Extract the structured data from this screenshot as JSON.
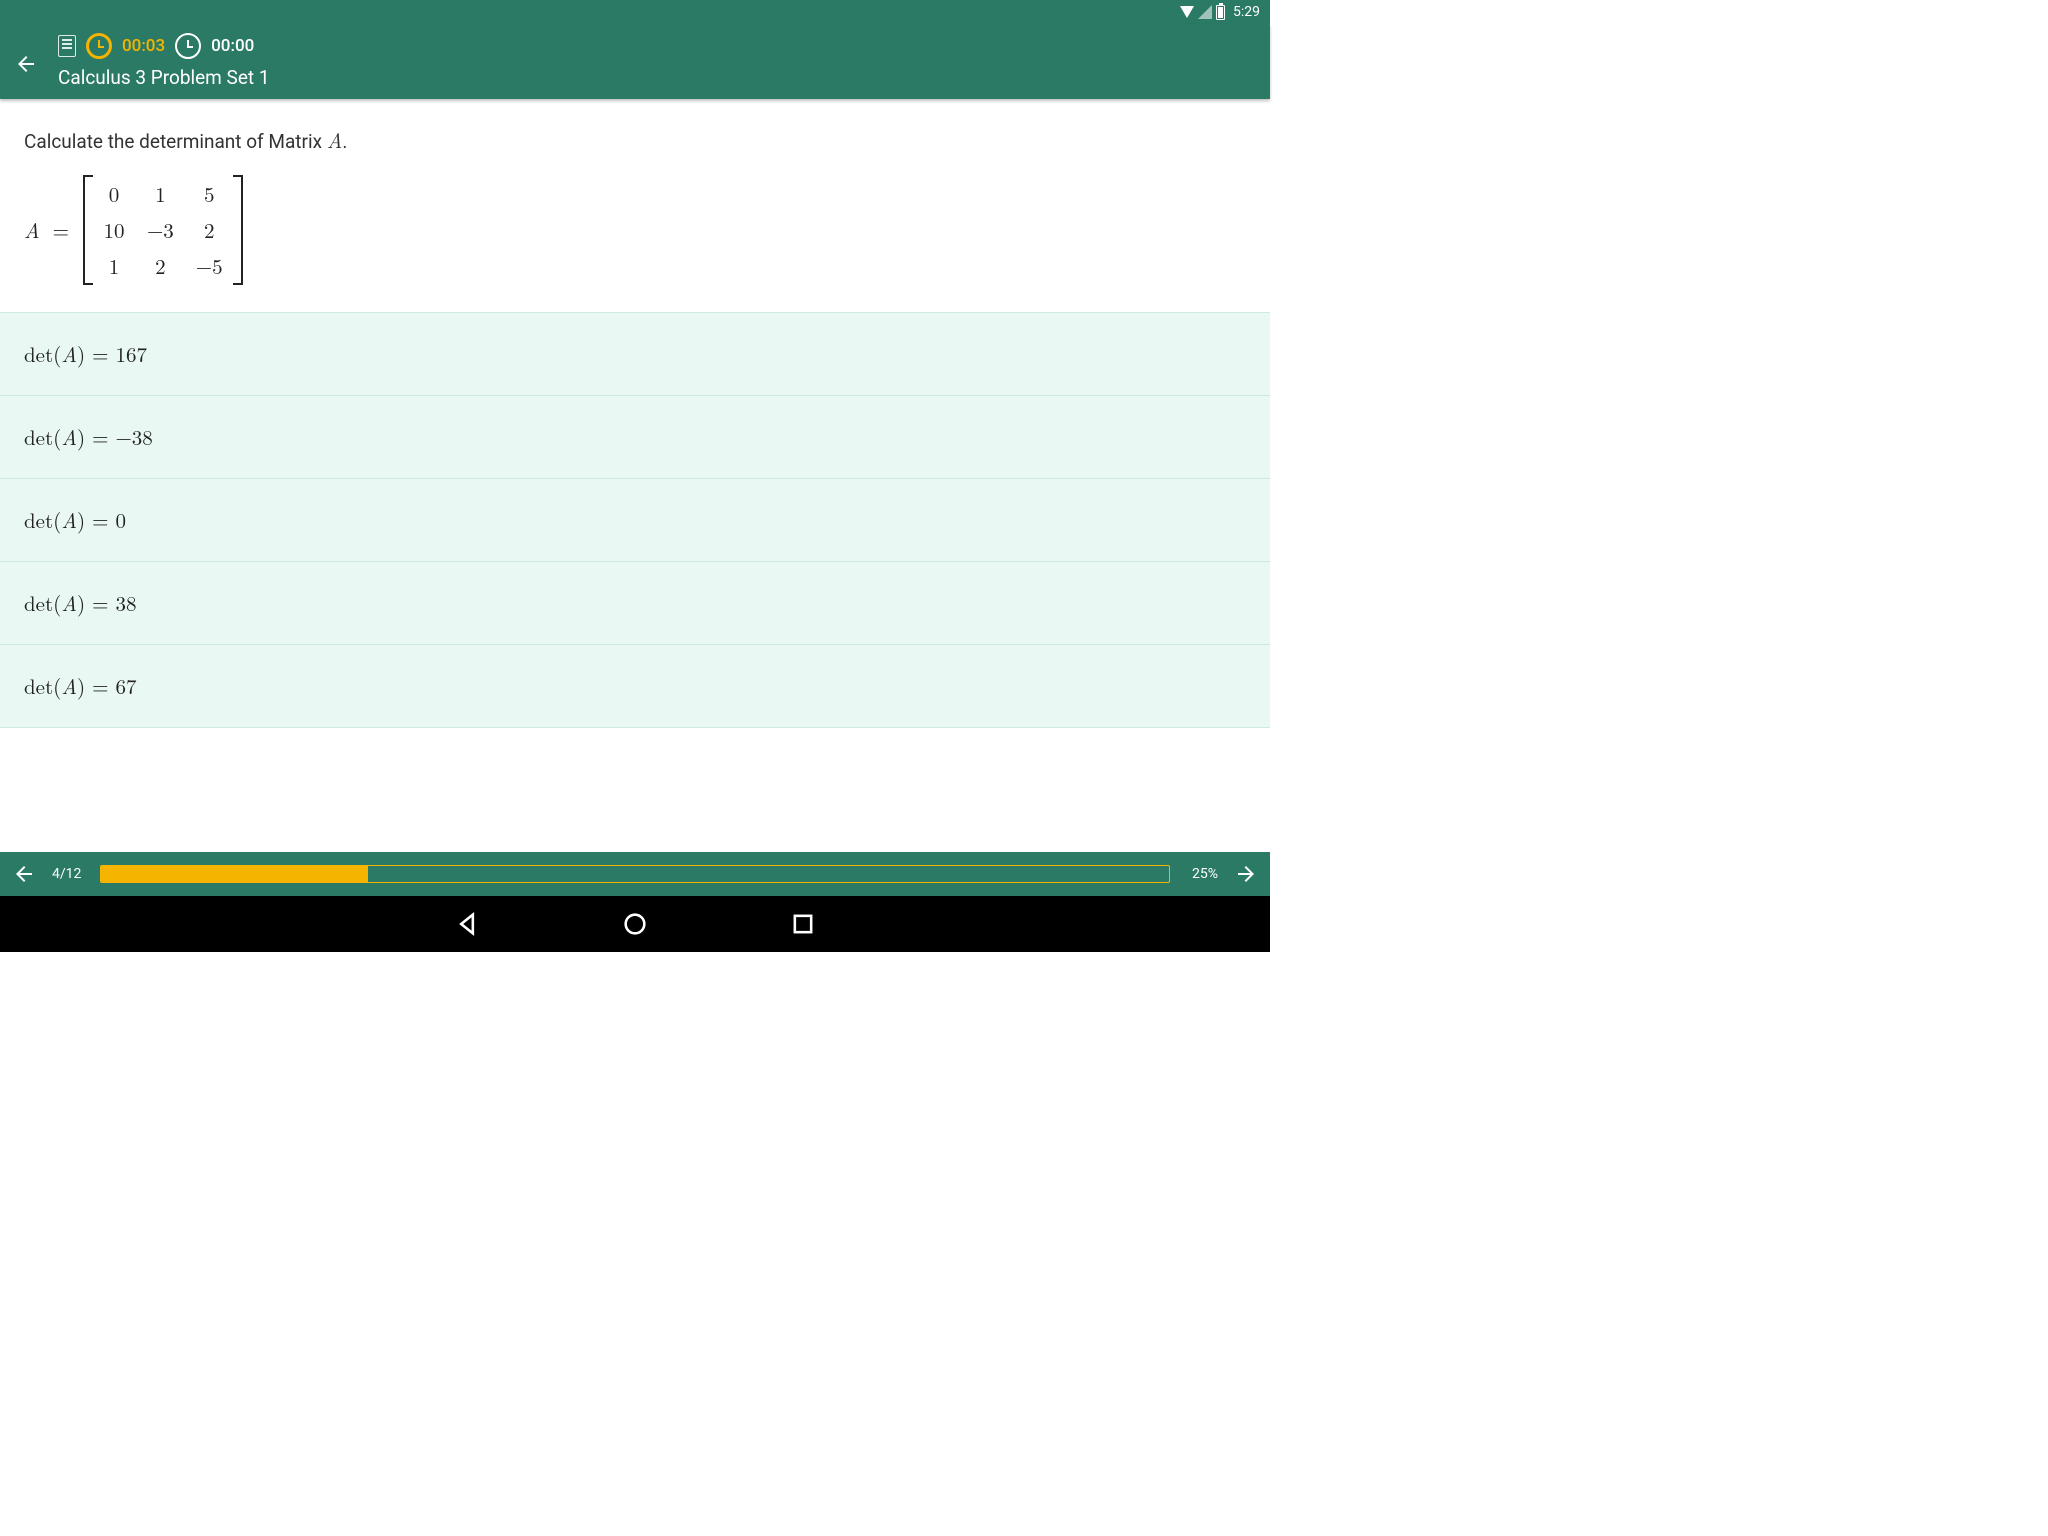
{
  "status": {
    "clock": "5:29"
  },
  "app_bar": {
    "elapsed": "00:03",
    "total": "00:00",
    "title": "Calculus 3 Problem Set 1"
  },
  "question": {
    "prompt_prefix": "Calculate the determinant of Matrix ",
    "matrix_symbol": "A",
    "prompt_suffix": ".",
    "matrix_label_prefix": "A",
    "matrix_label_eq": " = ",
    "matrix": [
      [
        "0",
        "1",
        "5"
      ],
      [
        "10",
        "−3",
        "2"
      ],
      [
        "1",
        "2",
        "−5"
      ]
    ]
  },
  "answers": [
    {
      "label_prefix": "det(",
      "var": "A",
      "label_mid": ") = ",
      "value": "167"
    },
    {
      "label_prefix": "det(",
      "var": "A",
      "label_mid": ") = ",
      "value": "−38"
    },
    {
      "label_prefix": "det(",
      "var": "A",
      "label_mid": ") = ",
      "value": "0"
    },
    {
      "label_prefix": "det(",
      "var": "A",
      "label_mid": ") = ",
      "value": "38"
    },
    {
      "label_prefix": "det(",
      "var": "A",
      "label_mid": ") = ",
      "value": "67"
    }
  ],
  "bottom": {
    "counter": "4/12",
    "percent": "25%",
    "progress_pct": 25
  }
}
